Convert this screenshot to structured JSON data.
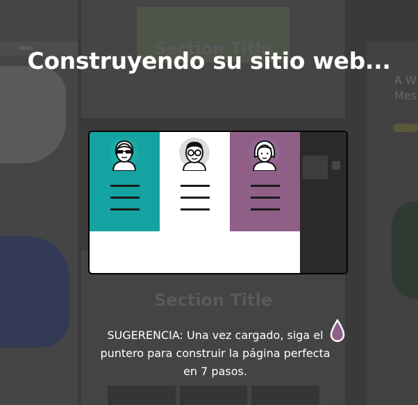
{
  "background": {
    "section_title": "Section Title",
    "right_text": "A W\nMes"
  },
  "overlay": {
    "title": "Construyendo su sitio web...",
    "tip_line1": "SUGERENCIA: Una vez cargado, siga el",
    "tip_line2": "puntero para construir la página perfecta",
    "tip_line3": "en 7 pasos."
  },
  "colors": {
    "panel_teal": "#15a3a1",
    "panel_white": "#ffffff",
    "panel_purple": "#8f5f88",
    "drop_icon": "#8f5f88"
  },
  "icons": [
    "avatar-glasses-icon",
    "avatar-woman-icon",
    "avatar-man-icon",
    "menu-lines-icon",
    "drop-pointer-icon"
  ]
}
